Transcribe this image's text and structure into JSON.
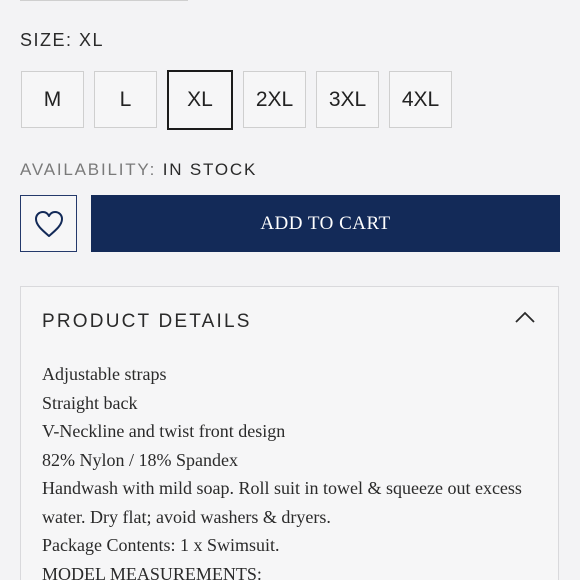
{
  "size_selector": {
    "label": "SIZE:",
    "selected_value": "XL",
    "options": [
      "M",
      "L",
      "XL",
      "2XL",
      "3XL",
      "4XL"
    ]
  },
  "availability": {
    "label": "AVAILABILITY:",
    "value": "IN STOCK"
  },
  "actions": {
    "wishlist_icon": "heart-outline-icon",
    "add_to_cart_label": "ADD TO CART"
  },
  "product_details": {
    "title": "PRODUCT DETAILS",
    "toggle_icon": "chevron-up-icon",
    "items": [
      "Adjustable straps",
      "Straight back",
      "V-Neckline and twist front design",
      "82% Nylon / 18% Spandex",
      "Handwash with mild soap. Roll suit in towel & squeeze out excess water. Dry flat; avoid washers & dryers.",
      "Package Contents: 1 x Swimsuit.",
      "MODEL MEASUREMENTS:"
    ]
  },
  "colors": {
    "primary": "#132a58",
    "background": "#f3f3f5",
    "border": "#cfcfcf"
  }
}
